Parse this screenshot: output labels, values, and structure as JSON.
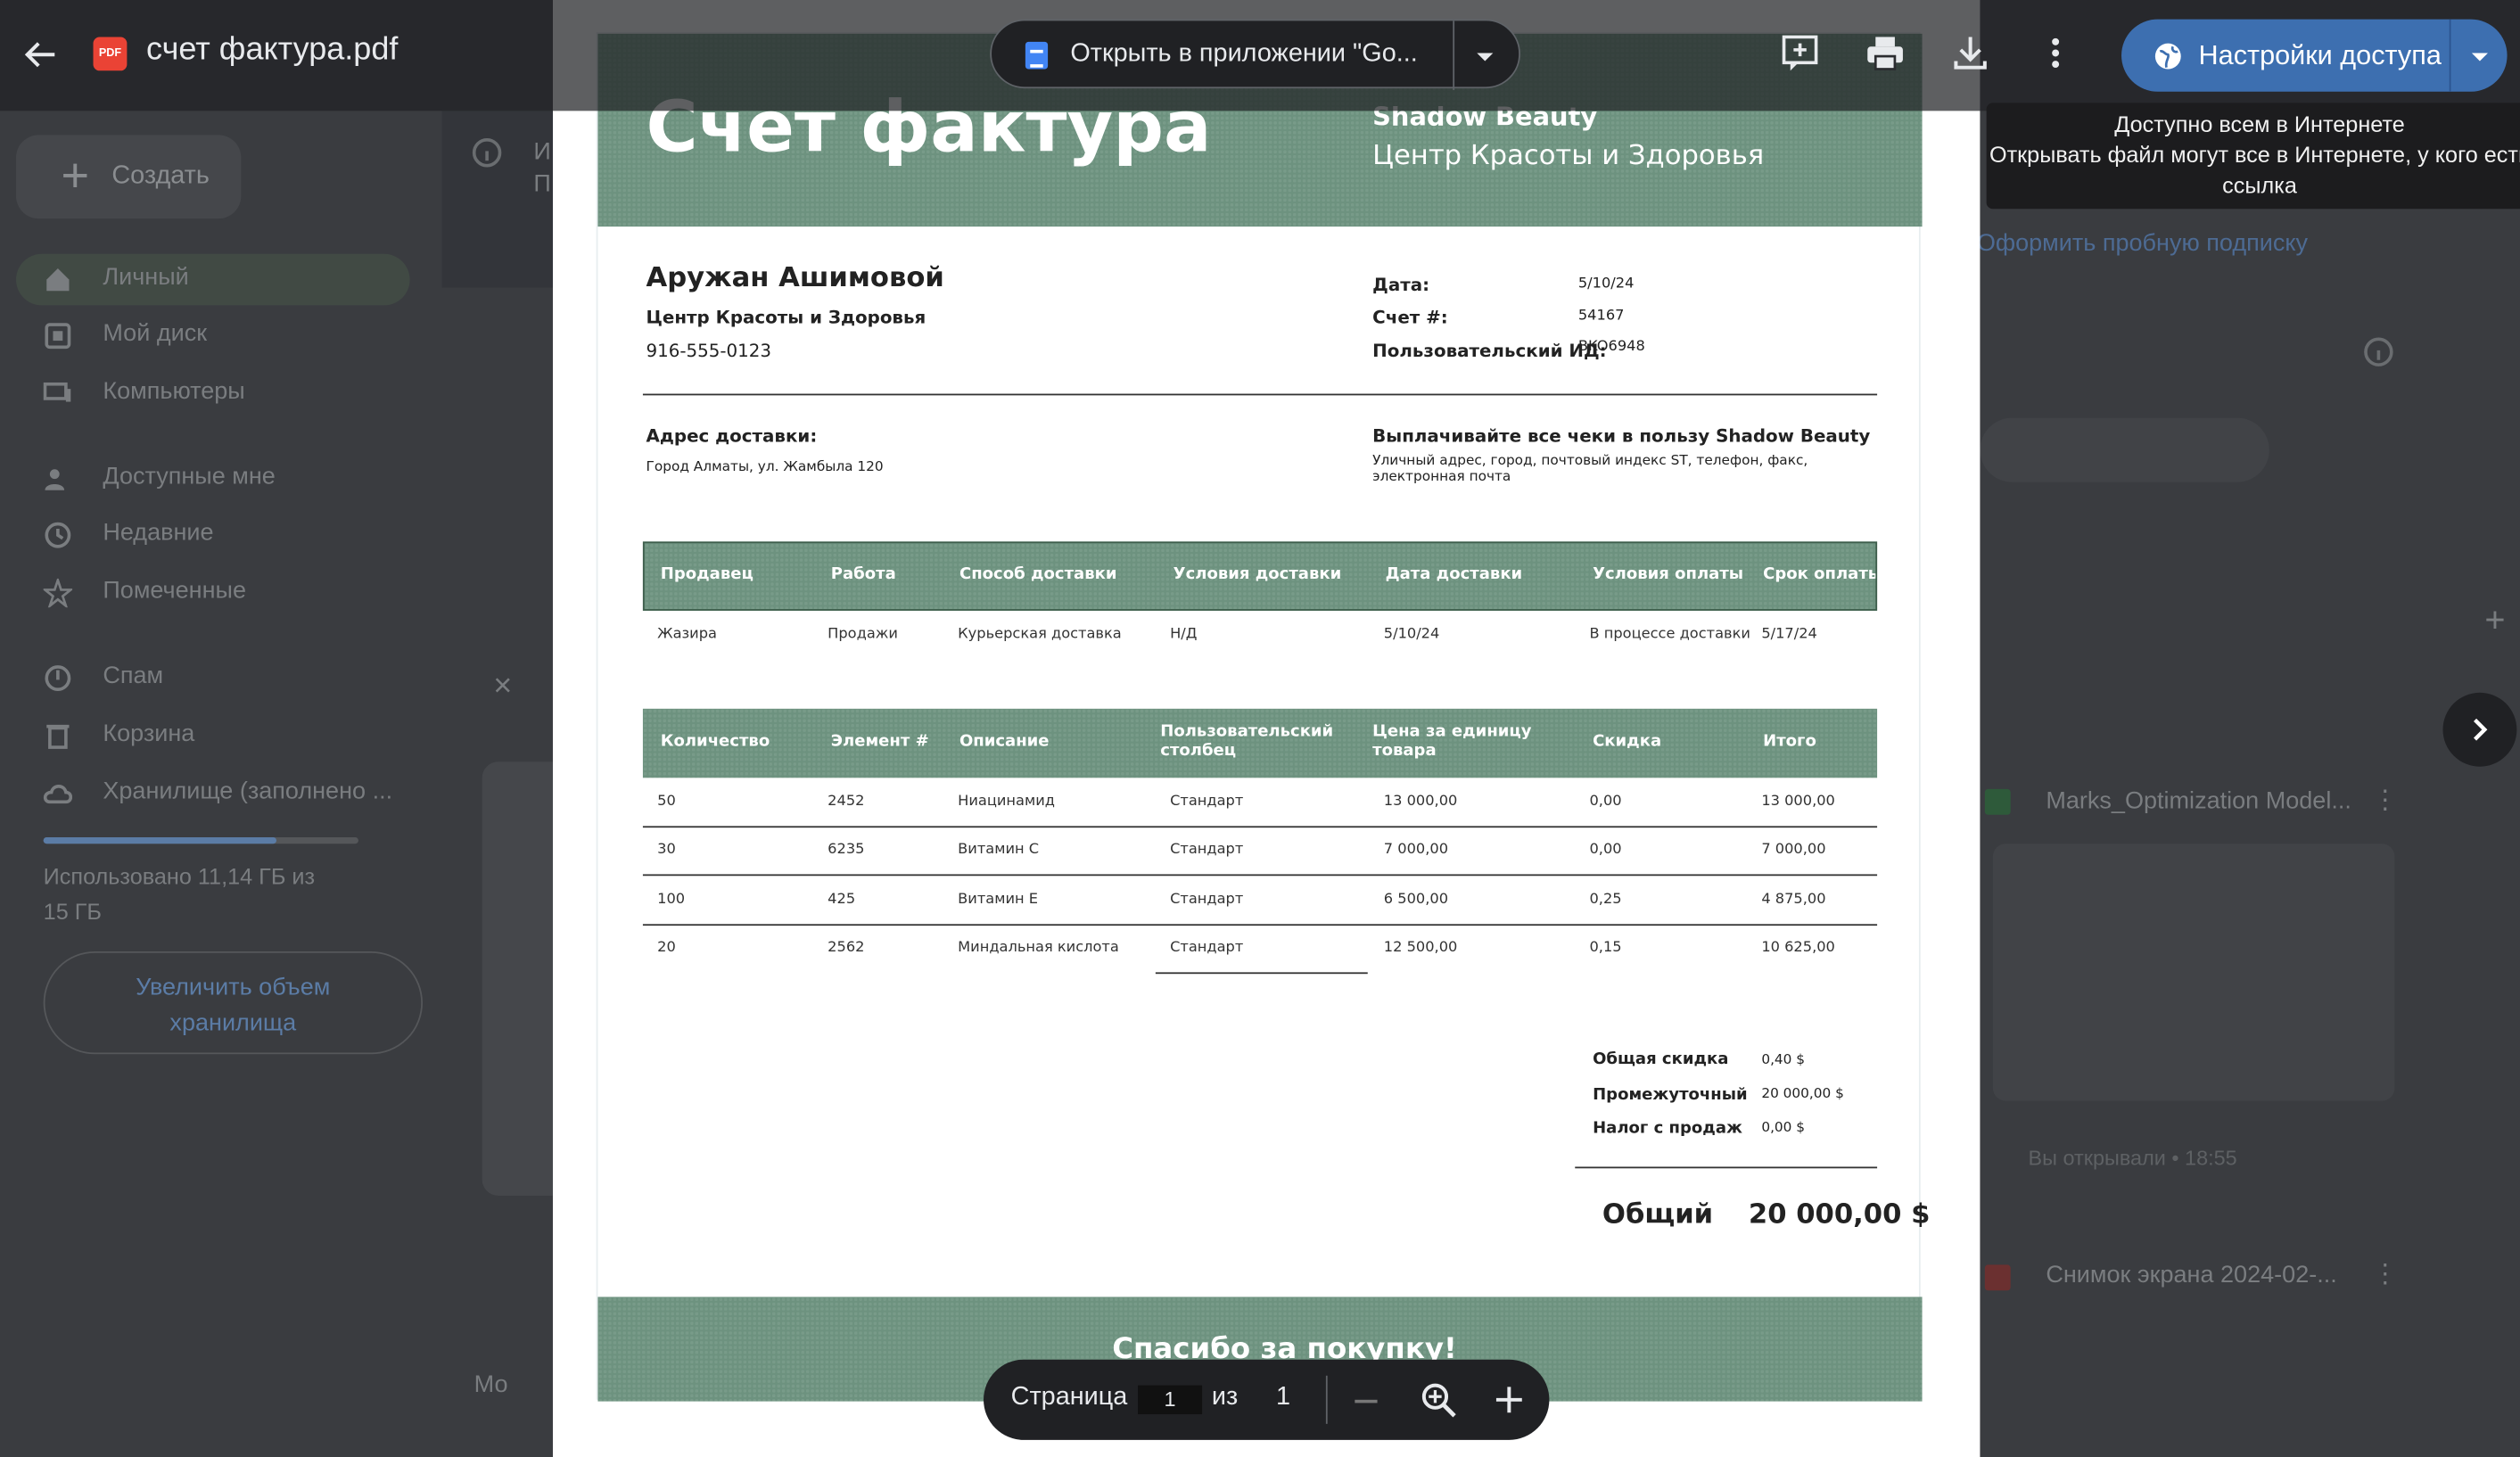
{
  "topbar": {
    "file_name": "счет фактура.pdf",
    "pdf_badge": "PDF",
    "open_with": "Открыть в приложении \"Go...",
    "share_label": "Настройки доступа",
    "tooltip_line1": "Доступно всем в Интернете",
    "tooltip_line2": "Открывать файл могут все в Интернете, у кого есть",
    "tooltip_line3": "ссылка"
  },
  "background": {
    "create_label": "Создать",
    "nav": [
      "Личный",
      "Мой диск",
      "Компьютеры",
      "Доступные мне",
      "Недавние",
      "Помеченные",
      "Спам",
      "Корзина",
      "Хранилище (заполнено ..."
    ],
    "storage_text_1": "Использовано 11,14 ГБ из",
    "storage_text_2": "15 ГБ",
    "storage_button_1": "Увеличить объем",
    "storage_button_2": "хранилища",
    "storage_fraction": 0.74,
    "trial_link": "Оформить пробную подписку",
    "file1": "Marks_Optimization Model...",
    "file1_meta": "Вы открывали • 18:55",
    "file2": "Снимок экрана 2024-02-...",
    "peek1": "И",
    "peek2": "П",
    "peek3": "Мо"
  },
  "invoice": {
    "title": "Счет фактура",
    "company": "Shadow Beauty",
    "company_sub": "Центр Красоты и Здоровья",
    "client_name": "Аружан Ашимовой",
    "client_org": "Центр Красоты и Здоровья",
    "client_phone": "916-555-0123",
    "date_label": "Дата:",
    "date_value": "5/10/24",
    "invoice_label": "Счет #:",
    "invoice_value": "54167",
    "userid_label": "Пользовательский ИД:",
    "userid_value": "BKO6948",
    "ship_label": "Адрес доставки:",
    "ship_value": "Город Алматы, ул. Жамбыла 120",
    "pay_label": "Выплачивайте все чеки в пользу Shadow Beauty",
    "pay_sub_1": "Уличный адрес, город, почтовый индекс ST, телефон, факс,",
    "pay_sub_2": "электронная почта",
    "ship_headers": [
      "Продавец",
      "Работа",
      "Способ доставки",
      "Условия доставки",
      "Дата доставки",
      "Условия оплаты",
      "Срок оплаты"
    ],
    "ship_row": [
      "Жазира",
      "Продажи",
      "Курьерская доставка",
      "Н/Д",
      "5/10/24",
      "В процессе доставки",
      "5/17/24"
    ],
    "item_headers": [
      "Количество",
      "Элемент #",
      "Описание",
      "Пользовательский столбец",
      "Цена за единицу товара",
      "Скидка",
      "Итого"
    ],
    "items": [
      [
        "50",
        "2452",
        "Ниацинамид",
        "Стандарт",
        "13 000,00",
        "0,00",
        "13 000,00"
      ],
      [
        "30",
        "6235",
        "Витамин C",
        "Стандарт",
        "7 000,00",
        "0,00",
        "7 000,00"
      ],
      [
        "100",
        "425",
        "Витамин E",
        "Стандарт",
        "6 500,00",
        "0,25",
        "4 875,00"
      ],
      [
        "20",
        "2562",
        "Миндальная кислота",
        "Стандарт",
        "12 500,00",
        "0,15",
        "10 625,00"
      ]
    ],
    "total_discount_label": "Общая скидка",
    "total_discount_value": "0,40 $",
    "subtotal_label": "Промежуточный и",
    "subtotal_value": "20 000,00 $",
    "tax_label": "Налог с продаж",
    "tax_value": "0,00 $",
    "grand_label": "Общий",
    "grand_value": "20 000,00 $",
    "thanks": "Спасибо за покупку!"
  },
  "pager": {
    "page_label": "Страница",
    "current": "1",
    "of_label": "из",
    "total": "1"
  }
}
